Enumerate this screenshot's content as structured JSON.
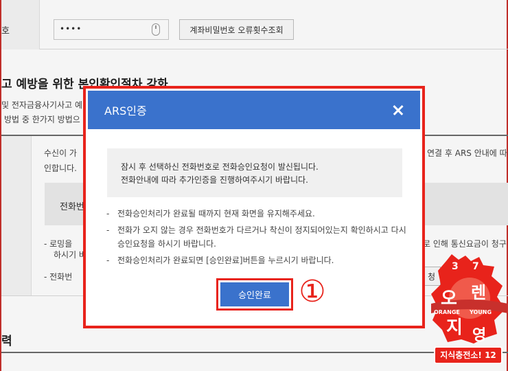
{
  "background": {
    "pw_label": "호",
    "pw_value": "••••",
    "check_button": "계좌비밀번호 오류횟수조회",
    "section_title": "고 예방을 위한 본인확인절차 강화",
    "section_desc1": "및 전자금융사기사고 예",
    "section_desc2": "방법 중 한가지 방법으",
    "para1": "수신이 가",
    "para2": "인합니다.",
    "para_right": "연결 후 ARS 안내에 따라",
    "gray_box_label": "전화번",
    "bullet1": "- 로밍을",
    "bullet1b": "하시기 바",
    "bullet_right": "로 인해 통신요금이 청구",
    "bullet2": "- 전화번",
    "bg_button": "청",
    "section3_title": "력"
  },
  "modal": {
    "title": "ARS인증",
    "close_label": "닫기",
    "notice_line1": "잠시 후 선택하신 전화번호로 전화승인요청이 발신됩니다.",
    "notice_line2": "전화안내에 따라 추가인증을 진행하여주시기 바랍니다.",
    "guide": [
      {
        "dash": "-",
        "text": "전화승인처리가 완료될 때까지 현재 화면을 유지해주세요."
      },
      {
        "dash": "-",
        "text": "전화가 오지 않는 경우 전화번호가 다르거나 착신이 정지되어있는지 확인하시고 다시 승인요청을 하시기 바랍니다."
      },
      {
        "dash": "-",
        "text": "전화승인처리가 완료되면 [승인완료]버튼을 누르시기 바랍니다."
      }
    ],
    "confirm_button": "승인완료",
    "step_marker": "①",
    "header_color": "#3a72cc",
    "highlight_color": "#e8231b"
  },
  "watermark": {
    "num_left": "3",
    "num_right": "7",
    "char_o": "오",
    "char_ren": "렌",
    "char_ji": "지",
    "char_yeong": "영",
    "orange": "ORANGE",
    "young": "YOUNG",
    "badge": "지식충전소! 12"
  }
}
